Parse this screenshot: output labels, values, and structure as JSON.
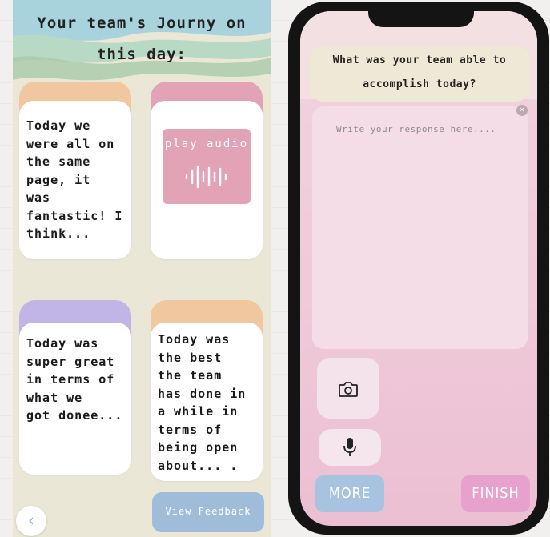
{
  "journey": {
    "title": "Your team's Journy on this day:",
    "cards": [
      {
        "text": "Today we\nwere all on\nthe same\npage, it\nwas\nfantastic! I\nthink..."
      },
      {
        "type": "audio",
        "label": "play audio"
      },
      {
        "text": "Today was\nsuper great\nin terms of\nwhat we\ngot donee..."
      },
      {
        "text": "Today was\nthe best\nthe team\nhas done in\na while in\nterms of\nbeing open\nabout... ."
      }
    ],
    "view_feedback": "View Feedback",
    "back_icon": "‹"
  },
  "phone": {
    "question": "What was your team able to accomplish today?",
    "placeholder": "Write your response here....",
    "clear_icon": "×",
    "more_label": "MORE",
    "finish_label": "FINISH"
  },
  "colors": {
    "peach": "#f0c79e",
    "pink": "#e2a3b7",
    "lavender": "#c0b5e6",
    "blue_button": "#9fbcd8",
    "finish_button": "#e6a1cd",
    "app_background": "#ebe7d6"
  }
}
